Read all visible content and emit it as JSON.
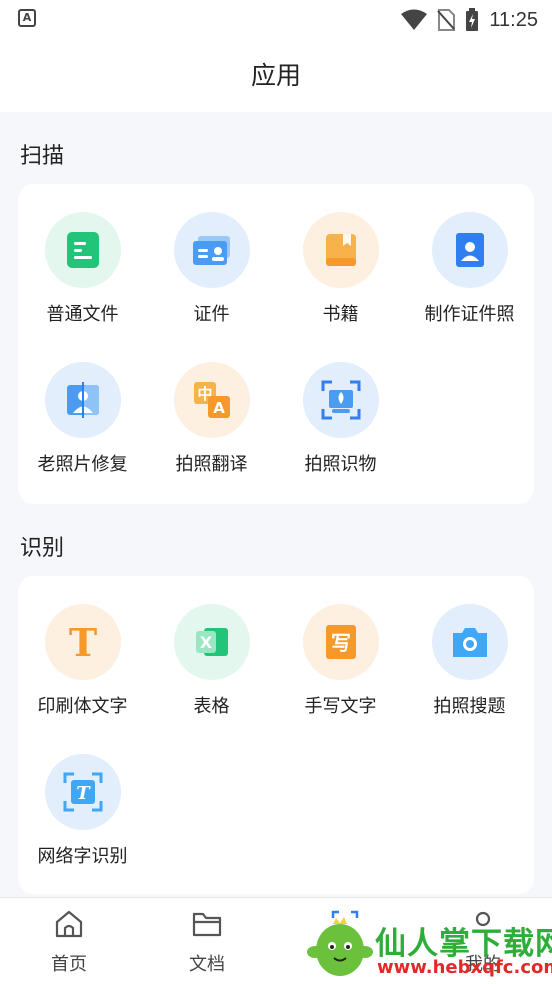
{
  "status": {
    "app_badge": "A",
    "time": "11:25"
  },
  "header": {
    "title": "应用"
  },
  "scan": {
    "title": "扫描",
    "items": [
      {
        "label": "普通文件",
        "icon": "document-icon"
      },
      {
        "label": "证件",
        "icon": "id-card-icon"
      },
      {
        "label": "书籍",
        "icon": "book-icon"
      },
      {
        "label": "制作证件照",
        "icon": "id-photo-icon"
      },
      {
        "label": "老照片修复",
        "icon": "photo-restore-icon"
      },
      {
        "label": "拍照翻译",
        "icon": "translate-icon"
      },
      {
        "label": "拍照识物",
        "icon": "object-recognition-icon"
      }
    ]
  },
  "recognize": {
    "title": "识别",
    "items": [
      {
        "label": "印刷体文字",
        "icon": "print-text-icon"
      },
      {
        "label": "表格",
        "icon": "excel-icon"
      },
      {
        "label": "手写文字",
        "icon": "handwriting-icon"
      },
      {
        "label": "拍照搜题",
        "icon": "camera-icon"
      },
      {
        "label": "网络字识别",
        "icon": "web-text-icon"
      }
    ]
  },
  "nav": {
    "home": "首页",
    "docs": "文档",
    "mine": "我的"
  },
  "watermark": {
    "text": "仙人掌下载网",
    "url": "www.hebxqfc.com"
  },
  "colors": {
    "green": "#2ecc8a",
    "blue": "#3f8ef5",
    "orange": "#f5a33a",
    "accent_bg_green": "#e3f7ef",
    "accent_bg_blue": "#e3eefc",
    "accent_bg_orange": "#fdf0e0"
  }
}
